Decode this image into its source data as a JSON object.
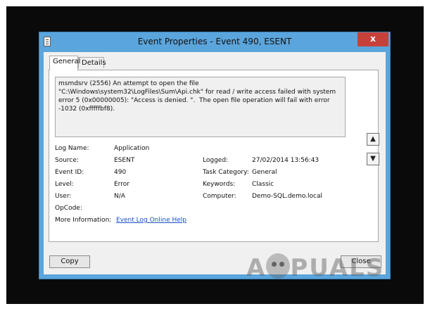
{
  "window": {
    "title": "Event Properties - Event 490, ESENT",
    "close_glyph": "x"
  },
  "tabs": [
    {
      "label": "General",
      "active": true
    },
    {
      "label": "Details",
      "active": false
    }
  ],
  "event": {
    "message": "msmdsrv (2556) An attempt to open the file \"C:\\Windows\\system32\\LogFiles\\Sum\\Api.chk\" for read / write access failed with system error 5 (0x00000005): \"Access is denied. \".  The open file operation will fail with error -1032 (0xfffffbf8).",
    "fields": {
      "log_name": {
        "label": "Log Name:",
        "value": "Application"
      },
      "source": {
        "label": "Source:",
        "value": "ESENT"
      },
      "event_id": {
        "label": "Event ID:",
        "value": "490"
      },
      "level": {
        "label": "Level:",
        "value": "Error"
      },
      "user": {
        "label": "User:",
        "value": "N/A"
      },
      "opcode": {
        "label": "OpCode:",
        "value": ""
      },
      "more_info": {
        "label": "More Information:",
        "value": "Event Log Online Help"
      },
      "logged": {
        "label": "Logged:",
        "value": "27/02/2014 13:56:43"
      },
      "task_category": {
        "label": "Task Category:",
        "value": "General"
      },
      "keywords": {
        "label": "Keywords:",
        "value": "Classic"
      },
      "computer": {
        "label": "Computer:",
        "value": "Demo-SQL.demo.local"
      }
    }
  },
  "buttons": {
    "copy": "Copy",
    "close": "Close"
  },
  "icons": {
    "up": "arrow-up-icon",
    "down": "arrow-down-icon"
  },
  "watermark": {
    "text_a": "A",
    "text_rest": "PUALS"
  }
}
